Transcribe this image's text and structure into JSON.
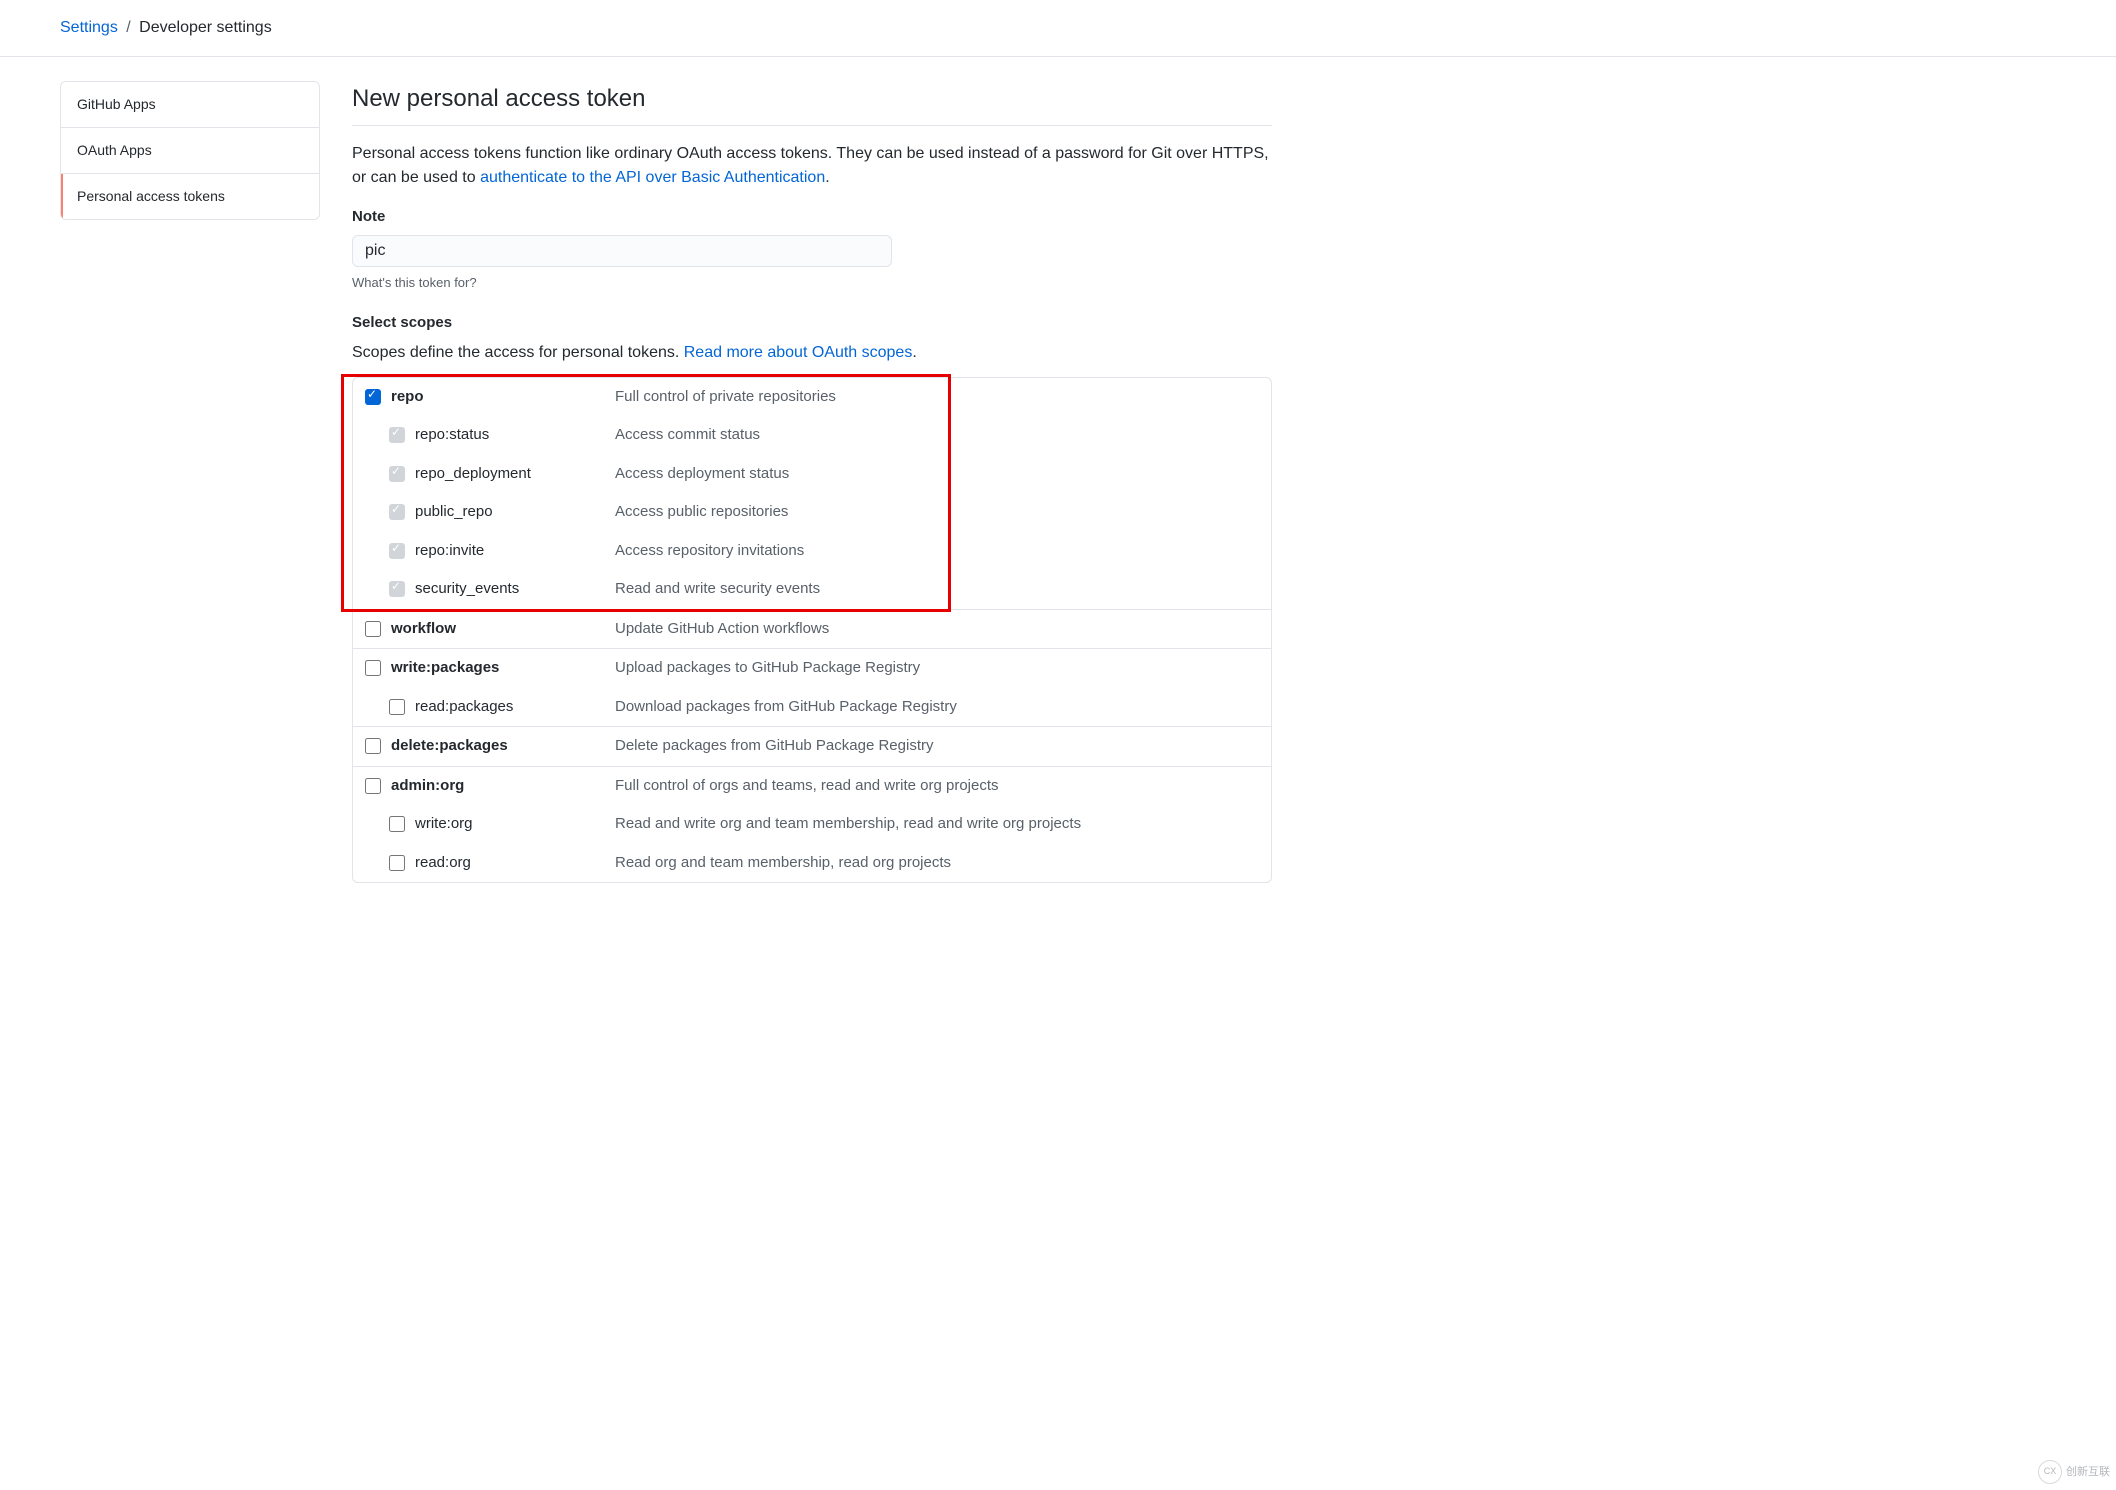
{
  "breadcrumb": {
    "parent": "Settings",
    "current": "Developer settings"
  },
  "sidebar": {
    "items": [
      {
        "label": "GitHub Apps",
        "active": false
      },
      {
        "label": "OAuth Apps",
        "active": false
      },
      {
        "label": "Personal access tokens",
        "active": true
      }
    ]
  },
  "page": {
    "title": "New personal access token",
    "description_prefix": "Personal access tokens function like ordinary OAuth access tokens. They can be used instead of a password for Git over HTTPS, or can be used to ",
    "description_link": "authenticate to the API over Basic Authentication",
    "description_suffix": "."
  },
  "note_field": {
    "label": "Note",
    "value": "pic",
    "hint": "What's this token for?"
  },
  "scopes": {
    "heading": "Select scopes",
    "intro_prefix": "Scopes define the access for personal tokens. ",
    "intro_link": "Read more about OAuth scopes",
    "intro_suffix": "."
  },
  "scope_groups": [
    {
      "name": "repo",
      "desc": "Full control of private repositories",
      "checked": true,
      "children": [
        {
          "name": "repo:status",
          "desc": "Access commit status",
          "implied": true
        },
        {
          "name": "repo_deployment",
          "desc": "Access deployment status",
          "implied": true
        },
        {
          "name": "public_repo",
          "desc": "Access public repositories",
          "implied": true
        },
        {
          "name": "repo:invite",
          "desc": "Access repository invitations",
          "implied": true
        },
        {
          "name": "security_events",
          "desc": "Read and write security events",
          "implied": true
        }
      ]
    },
    {
      "name": "workflow",
      "desc": "Update GitHub Action workflows",
      "checked": false,
      "children": []
    },
    {
      "name": "write:packages",
      "desc": "Upload packages to GitHub Package Registry",
      "checked": false,
      "children": [
        {
          "name": "read:packages",
          "desc": "Download packages from GitHub Package Registry",
          "implied": false
        }
      ]
    },
    {
      "name": "delete:packages",
      "desc": "Delete packages from GitHub Package Registry",
      "checked": false,
      "children": []
    },
    {
      "name": "admin:org",
      "desc": "Full control of orgs and teams, read and write org projects",
      "checked": false,
      "children": [
        {
          "name": "write:org",
          "desc": "Read and write org and team membership, read and write org projects",
          "implied": false
        },
        {
          "name": "read:org",
          "desc": "Read org and team membership, read org projects",
          "implied": false
        }
      ]
    }
  ],
  "watermark": {
    "text": "创新互联"
  }
}
